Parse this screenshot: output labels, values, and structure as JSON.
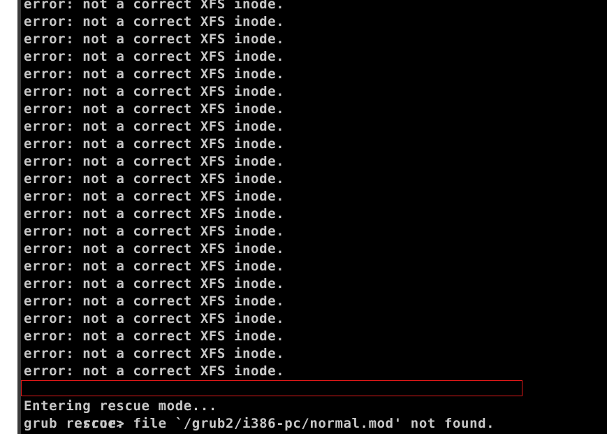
{
  "terminal": {
    "error_lines": [
      "error: not a correct XFS inode.",
      "error: not a correct XFS inode.",
      "error: not a correct XFS inode.",
      "error: not a correct XFS inode.",
      "error: not a correct XFS inode.",
      "error: not a correct XFS inode.",
      "error: not a correct XFS inode.",
      "error: not a correct XFS inode.",
      "error: not a correct XFS inode.",
      "error: not a correct XFS inode.",
      "error: not a correct XFS inode.",
      "error: not a correct XFS inode.",
      "error: not a correct XFS inode.",
      "error: not a correct XFS inode.",
      "error: not a correct XFS inode.",
      "error: not a correct XFS inode.",
      "error: not a correct XFS inode.",
      "error: not a correct XFS inode.",
      "error: not a correct XFS inode.",
      "error: not a correct XFS inode.",
      "error: not a correct XFS inode.",
      "error: not a correct XFS inode."
    ],
    "highlighted_line": "error: file `/grub2/i386-pc/normal.mod' not found.",
    "status_line": "Entering rescue mode...",
    "prompt": "grub rescue>",
    "highlight_color": "#e01818",
    "text_color": "#c8c8c8",
    "background_color": "#000000"
  }
}
